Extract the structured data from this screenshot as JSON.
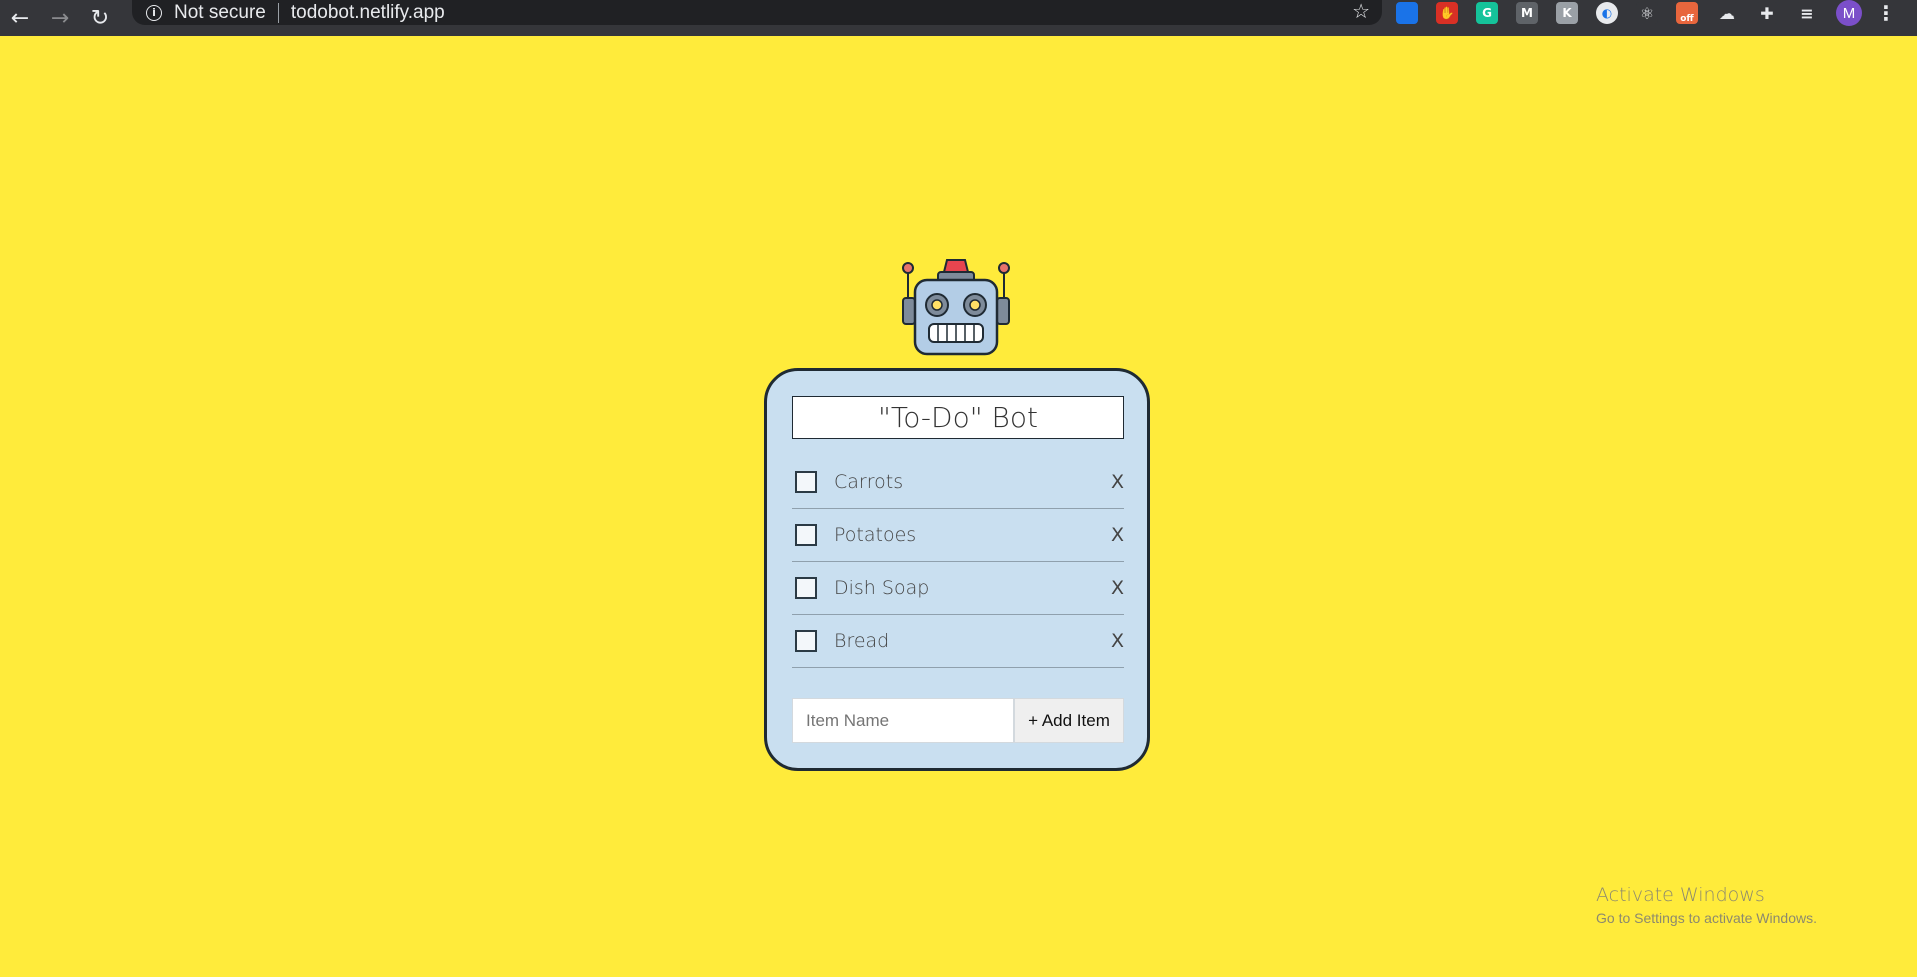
{
  "browser": {
    "security_label": "Not secure",
    "url": "todobot.netlify.app",
    "profile_initial": "M",
    "extensions": [
      {
        "name": "blue-extension-icon",
        "color": "#1a73e8",
        "glyph": ""
      },
      {
        "name": "red-hand-extension-icon",
        "color": "#d93025",
        "glyph": "✋"
      },
      {
        "name": "grammarly-extension-icon",
        "color": "#15c39a",
        "glyph": "G"
      },
      {
        "name": "m-extension-icon",
        "color": "#5f6368",
        "glyph": "M"
      },
      {
        "name": "gray-extension-icon",
        "color": "#9aa0a6",
        "glyph": "K"
      },
      {
        "name": "circle-extension-icon",
        "color": "#e8eaed",
        "glyph": "◐"
      },
      {
        "name": "react-devtools-icon",
        "color": "#35363a",
        "glyph": "⚛"
      },
      {
        "name": "pdf-off-extension-icon",
        "color": "#e8663d",
        "glyph": "off"
      },
      {
        "name": "cloud-extension-icon",
        "color": "#35363a",
        "glyph": "☁"
      },
      {
        "name": "puzzle-extensions-icon",
        "color": "#35363a",
        "glyph": "✚"
      },
      {
        "name": "media-queue-icon",
        "color": "#35363a",
        "glyph": "≡"
      }
    ]
  },
  "app": {
    "title": "\"To-Do\" Bot",
    "items": [
      {
        "label": "Carrots",
        "delete": "X",
        "checked": false
      },
      {
        "label": "Potatoes",
        "delete": "X",
        "checked": false
      },
      {
        "label": "Dish Soap",
        "delete": "X",
        "checked": false
      },
      {
        "label": "Bread",
        "delete": "X",
        "checked": false
      }
    ],
    "input_placeholder": "Item Name",
    "input_value": "",
    "add_button_label": "+ Add Item",
    "colors": {
      "background": "#ffeb3b",
      "card": "#c9dff0",
      "border": "#1f2a33"
    }
  },
  "watermark": {
    "title": "Activate Windows",
    "subtitle": "Go to Settings to activate Windows."
  }
}
